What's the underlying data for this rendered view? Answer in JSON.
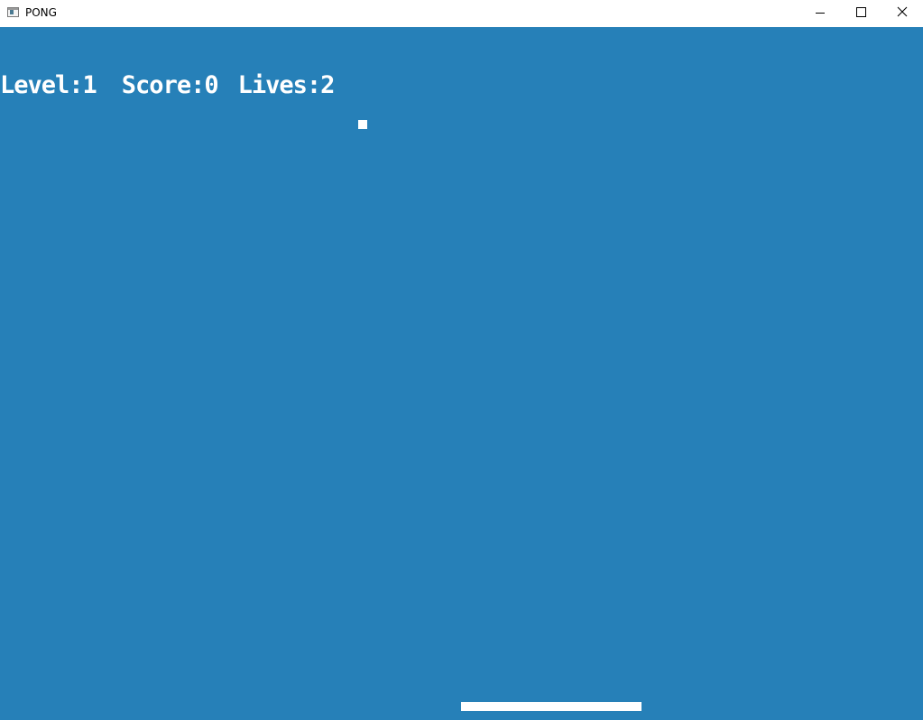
{
  "window": {
    "title": "PONG",
    "icon": "app-window-icon",
    "controls": [
      "minimize-icon",
      "maximize-icon",
      "close-icon"
    ]
  },
  "game": {
    "background_color": "#2680b8",
    "foreground_color": "#ffffff",
    "hud": {
      "level_text": "Level:1",
      "score_text": "Score:0",
      "lives_text": "Lives:2",
      "level": 1,
      "score": 0,
      "lives": 2
    }
  }
}
